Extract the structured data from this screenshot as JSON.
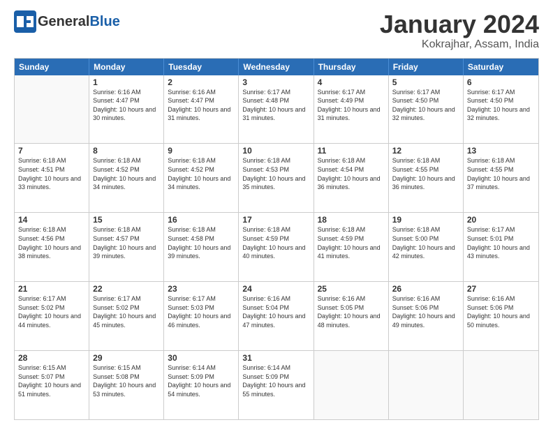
{
  "logo": {
    "general": "General",
    "blue": "Blue"
  },
  "title": "January 2024",
  "location": "Kokrajhar, Assam, India",
  "header": {
    "days": [
      "Sunday",
      "Monday",
      "Tuesday",
      "Wednesday",
      "Thursday",
      "Friday",
      "Saturday"
    ]
  },
  "weeks": [
    [
      {
        "day": "",
        "sunrise": "",
        "sunset": "",
        "daylight": ""
      },
      {
        "day": "1",
        "sunrise": "Sunrise: 6:16 AM",
        "sunset": "Sunset: 4:47 PM",
        "daylight": "Daylight: 10 hours and 30 minutes."
      },
      {
        "day": "2",
        "sunrise": "Sunrise: 6:16 AM",
        "sunset": "Sunset: 4:47 PM",
        "daylight": "Daylight: 10 hours and 31 minutes."
      },
      {
        "day": "3",
        "sunrise": "Sunrise: 6:17 AM",
        "sunset": "Sunset: 4:48 PM",
        "daylight": "Daylight: 10 hours and 31 minutes."
      },
      {
        "day": "4",
        "sunrise": "Sunrise: 6:17 AM",
        "sunset": "Sunset: 4:49 PM",
        "daylight": "Daylight: 10 hours and 31 minutes."
      },
      {
        "day": "5",
        "sunrise": "Sunrise: 6:17 AM",
        "sunset": "Sunset: 4:50 PM",
        "daylight": "Daylight: 10 hours and 32 minutes."
      },
      {
        "day": "6",
        "sunrise": "Sunrise: 6:17 AM",
        "sunset": "Sunset: 4:50 PM",
        "daylight": "Daylight: 10 hours and 32 minutes."
      }
    ],
    [
      {
        "day": "7",
        "sunrise": "Sunrise: 6:18 AM",
        "sunset": "Sunset: 4:51 PM",
        "daylight": "Daylight: 10 hours and 33 minutes."
      },
      {
        "day": "8",
        "sunrise": "Sunrise: 6:18 AM",
        "sunset": "Sunset: 4:52 PM",
        "daylight": "Daylight: 10 hours and 34 minutes."
      },
      {
        "day": "9",
        "sunrise": "Sunrise: 6:18 AM",
        "sunset": "Sunset: 4:52 PM",
        "daylight": "Daylight: 10 hours and 34 minutes."
      },
      {
        "day": "10",
        "sunrise": "Sunrise: 6:18 AM",
        "sunset": "Sunset: 4:53 PM",
        "daylight": "Daylight: 10 hours and 35 minutes."
      },
      {
        "day": "11",
        "sunrise": "Sunrise: 6:18 AM",
        "sunset": "Sunset: 4:54 PM",
        "daylight": "Daylight: 10 hours and 36 minutes."
      },
      {
        "day": "12",
        "sunrise": "Sunrise: 6:18 AM",
        "sunset": "Sunset: 4:55 PM",
        "daylight": "Daylight: 10 hours and 36 minutes."
      },
      {
        "day": "13",
        "sunrise": "Sunrise: 6:18 AM",
        "sunset": "Sunset: 4:55 PM",
        "daylight": "Daylight: 10 hours and 37 minutes."
      }
    ],
    [
      {
        "day": "14",
        "sunrise": "Sunrise: 6:18 AM",
        "sunset": "Sunset: 4:56 PM",
        "daylight": "Daylight: 10 hours and 38 minutes."
      },
      {
        "day": "15",
        "sunrise": "Sunrise: 6:18 AM",
        "sunset": "Sunset: 4:57 PM",
        "daylight": "Daylight: 10 hours and 39 minutes."
      },
      {
        "day": "16",
        "sunrise": "Sunrise: 6:18 AM",
        "sunset": "Sunset: 4:58 PM",
        "daylight": "Daylight: 10 hours and 39 minutes."
      },
      {
        "day": "17",
        "sunrise": "Sunrise: 6:18 AM",
        "sunset": "Sunset: 4:59 PM",
        "daylight": "Daylight: 10 hours and 40 minutes."
      },
      {
        "day": "18",
        "sunrise": "Sunrise: 6:18 AM",
        "sunset": "Sunset: 4:59 PM",
        "daylight": "Daylight: 10 hours and 41 minutes."
      },
      {
        "day": "19",
        "sunrise": "Sunrise: 6:18 AM",
        "sunset": "Sunset: 5:00 PM",
        "daylight": "Daylight: 10 hours and 42 minutes."
      },
      {
        "day": "20",
        "sunrise": "Sunrise: 6:17 AM",
        "sunset": "Sunset: 5:01 PM",
        "daylight": "Daylight: 10 hours and 43 minutes."
      }
    ],
    [
      {
        "day": "21",
        "sunrise": "Sunrise: 6:17 AM",
        "sunset": "Sunset: 5:02 PM",
        "daylight": "Daylight: 10 hours and 44 minutes."
      },
      {
        "day": "22",
        "sunrise": "Sunrise: 6:17 AM",
        "sunset": "Sunset: 5:02 PM",
        "daylight": "Daylight: 10 hours and 45 minutes."
      },
      {
        "day": "23",
        "sunrise": "Sunrise: 6:17 AM",
        "sunset": "Sunset: 5:03 PM",
        "daylight": "Daylight: 10 hours and 46 minutes."
      },
      {
        "day": "24",
        "sunrise": "Sunrise: 6:16 AM",
        "sunset": "Sunset: 5:04 PM",
        "daylight": "Daylight: 10 hours and 47 minutes."
      },
      {
        "day": "25",
        "sunrise": "Sunrise: 6:16 AM",
        "sunset": "Sunset: 5:05 PM",
        "daylight": "Daylight: 10 hours and 48 minutes."
      },
      {
        "day": "26",
        "sunrise": "Sunrise: 6:16 AM",
        "sunset": "Sunset: 5:06 PM",
        "daylight": "Daylight: 10 hours and 49 minutes."
      },
      {
        "day": "27",
        "sunrise": "Sunrise: 6:16 AM",
        "sunset": "Sunset: 5:06 PM",
        "daylight": "Daylight: 10 hours and 50 minutes."
      }
    ],
    [
      {
        "day": "28",
        "sunrise": "Sunrise: 6:15 AM",
        "sunset": "Sunset: 5:07 PM",
        "daylight": "Daylight: 10 hours and 51 minutes."
      },
      {
        "day": "29",
        "sunrise": "Sunrise: 6:15 AM",
        "sunset": "Sunset: 5:08 PM",
        "daylight": "Daylight: 10 hours and 53 minutes."
      },
      {
        "day": "30",
        "sunrise": "Sunrise: 6:14 AM",
        "sunset": "Sunset: 5:09 PM",
        "daylight": "Daylight: 10 hours and 54 minutes."
      },
      {
        "day": "31",
        "sunrise": "Sunrise: 6:14 AM",
        "sunset": "Sunset: 5:09 PM",
        "daylight": "Daylight: 10 hours and 55 minutes."
      },
      {
        "day": "",
        "sunrise": "",
        "sunset": "",
        "daylight": ""
      },
      {
        "day": "",
        "sunrise": "",
        "sunset": "",
        "daylight": ""
      },
      {
        "day": "",
        "sunrise": "",
        "sunset": "",
        "daylight": ""
      }
    ]
  ]
}
